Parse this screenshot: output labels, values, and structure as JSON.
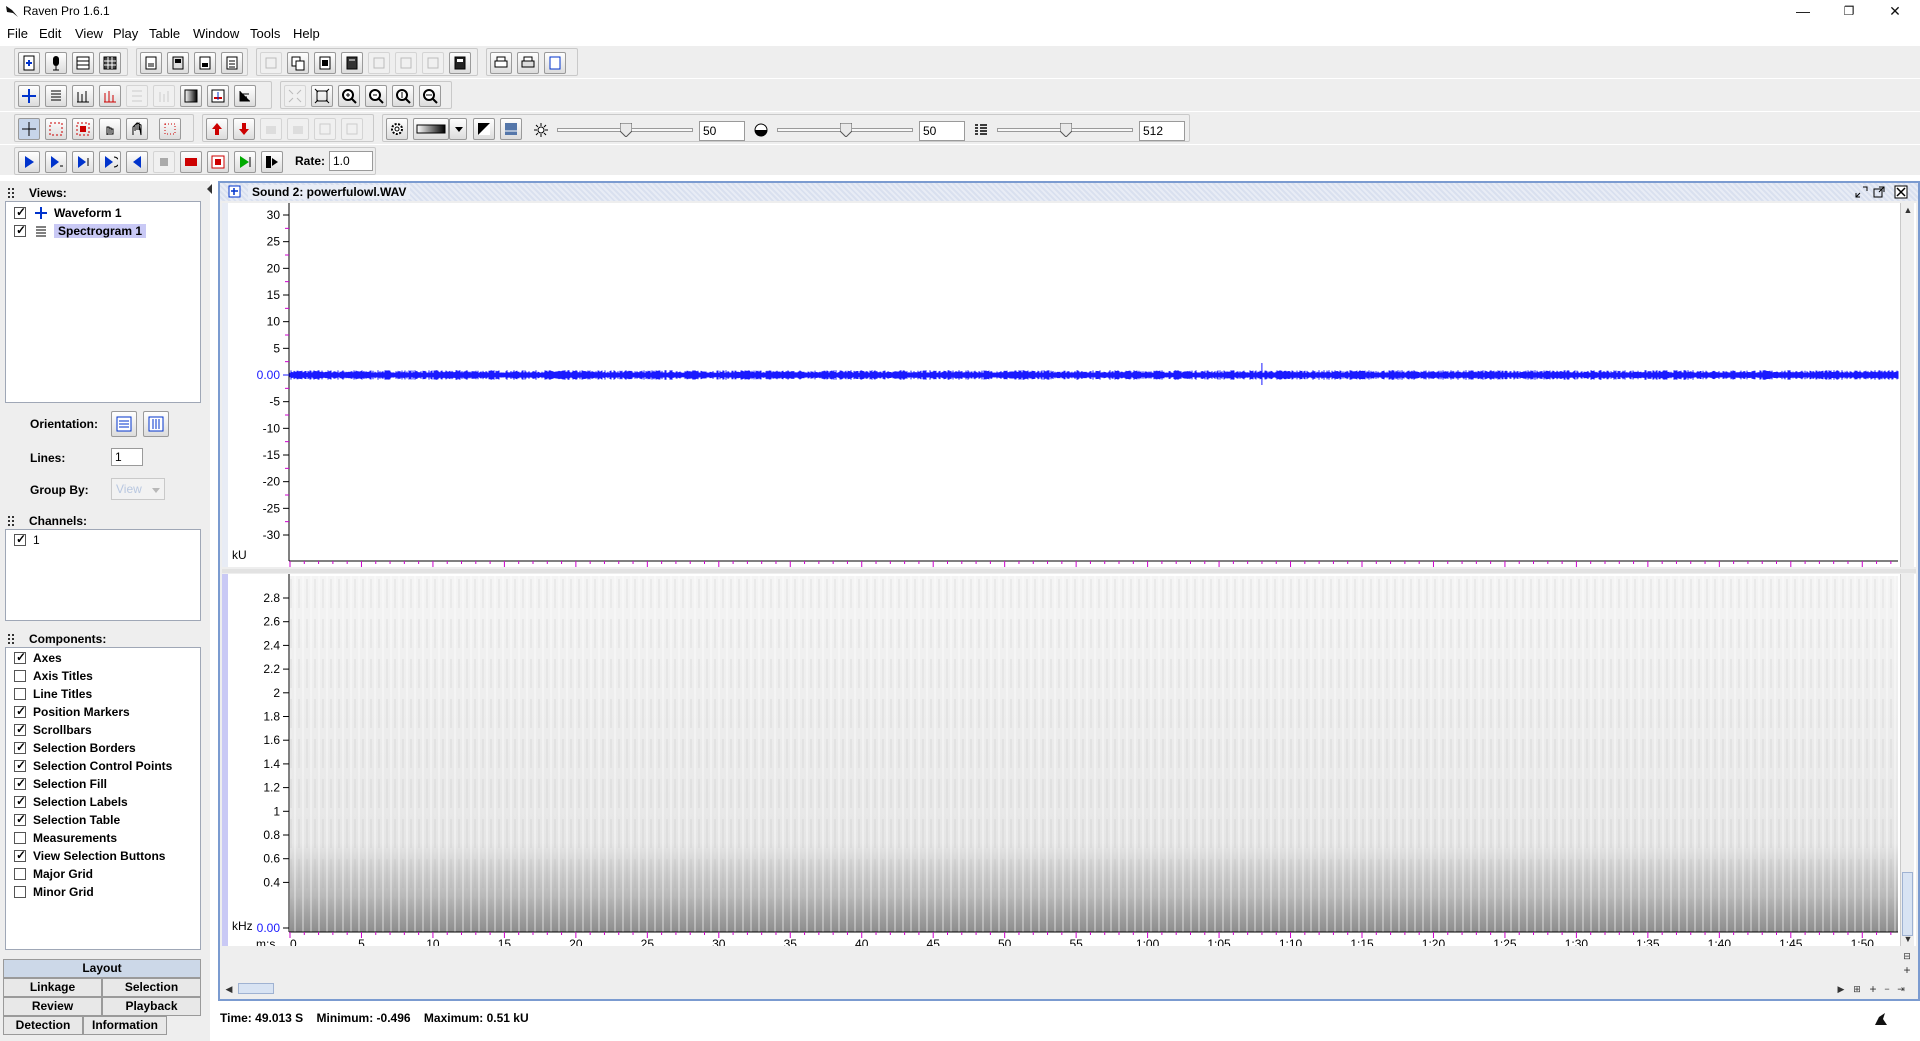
{
  "app": {
    "title": "Raven Pro 1.6.1"
  },
  "window_controls": {
    "minimize": "—",
    "maximize": "❐",
    "close": "✕"
  },
  "menu": [
    {
      "label": "File"
    },
    {
      "label": "Edit"
    },
    {
      "label": "View"
    },
    {
      "label": "Play"
    },
    {
      "label": "Table"
    },
    {
      "label": "Window"
    },
    {
      "label": "Tools"
    },
    {
      "label": "Help"
    }
  ],
  "toolbar": {
    "brightness_value": "50",
    "contrast_value": "50",
    "size_value": "512",
    "rate_label": "Rate:",
    "rate_value": "1.0"
  },
  "left_panel": {
    "views_header": "Views:",
    "views": [
      {
        "label": "Waveform 1",
        "checked": true,
        "selected": false,
        "icon": "waveform-icon"
      },
      {
        "label": "Spectrogram 1",
        "checked": true,
        "selected": true,
        "icon": "spectrogram-icon"
      }
    ],
    "orientation_label": "Orientation:",
    "lines_label": "Lines:",
    "lines_value": "1",
    "group_by_label": "Group By:",
    "group_by_value": "View",
    "channels_header": "Channels:",
    "channels": [
      {
        "label": "1",
        "checked": true
      }
    ],
    "components_header": "Components:",
    "components": [
      {
        "label": "Axes",
        "checked": true
      },
      {
        "label": "Axis Titles",
        "checked": false
      },
      {
        "label": "Line Titles",
        "checked": false
      },
      {
        "label": "Position Markers",
        "checked": true
      },
      {
        "label": "Scrollbars",
        "checked": true
      },
      {
        "label": "Selection Borders",
        "checked": true
      },
      {
        "label": "Selection Control Points",
        "checked": true
      },
      {
        "label": "Selection Fill",
        "checked": true
      },
      {
        "label": "Selection Labels",
        "checked": true
      },
      {
        "label": "Selection Table",
        "checked": true
      },
      {
        "label": "Measurements",
        "checked": false
      },
      {
        "label": "View Selection Buttons",
        "checked": true
      },
      {
        "label": "Major Grid",
        "checked": false
      },
      {
        "label": "Minor Grid",
        "checked": false
      }
    ],
    "tabs": {
      "layout": "Layout",
      "linkage": "Linkage",
      "selection": "Selection",
      "review": "Review",
      "playback": "Playback",
      "detection": "Detection",
      "information": "Information"
    }
  },
  "sound_window": {
    "title": "Sound 2: powerfulowl.WAV",
    "waveform": {
      "y_unit": "kU",
      "x_unit": "m:s",
      "y_ticks": [
        "30",
        "25",
        "20",
        "15",
        "10",
        "5",
        "0.00",
        "-5",
        "-10",
        "-15",
        "-20",
        "-25",
        "-30"
      ],
      "x_ticks": [
        "0",
        "5",
        "10",
        "15",
        "20",
        "25",
        "30",
        "35",
        "40",
        "45",
        "50",
        "55",
        "1:00",
        "1:05",
        "1:10",
        "1:15",
        "1:20",
        "1:25",
        "1:30",
        "1:35",
        "1:40",
        "1:45",
        "1:50"
      ],
      "color": "#1a1aff"
    },
    "spectrogram": {
      "y_unit": "kHz",
      "x_unit": "m:s",
      "y_ticks": [
        "2.8",
        "2.6",
        "2.4",
        "2.2",
        "2",
        "1.8",
        "1.6",
        "1.4",
        "1.2",
        "1",
        "0.8",
        "0.6",
        "0.4",
        "0.00"
      ],
      "x_ticks": [
        "0",
        "5",
        "10",
        "15",
        "20",
        "25",
        "30",
        "35",
        "40",
        "45",
        "50",
        "55",
        "1:00",
        "1:05",
        "1:10",
        "1:15",
        "1:20",
        "1:25",
        "1:30",
        "1:35",
        "1:40",
        "1:45",
        "1:50"
      ]
    }
  },
  "status": {
    "time_label": "Time:",
    "time_value": "49.013 S",
    "min_label": "Minimum:",
    "min_value": "-0.496",
    "max_label": "Maximum:",
    "max_value": "0.51 kU"
  },
  "accent": {
    "magenta": "#cc00cc",
    "wave": "#1a1aff",
    "frame": "#7b9bd0"
  }
}
